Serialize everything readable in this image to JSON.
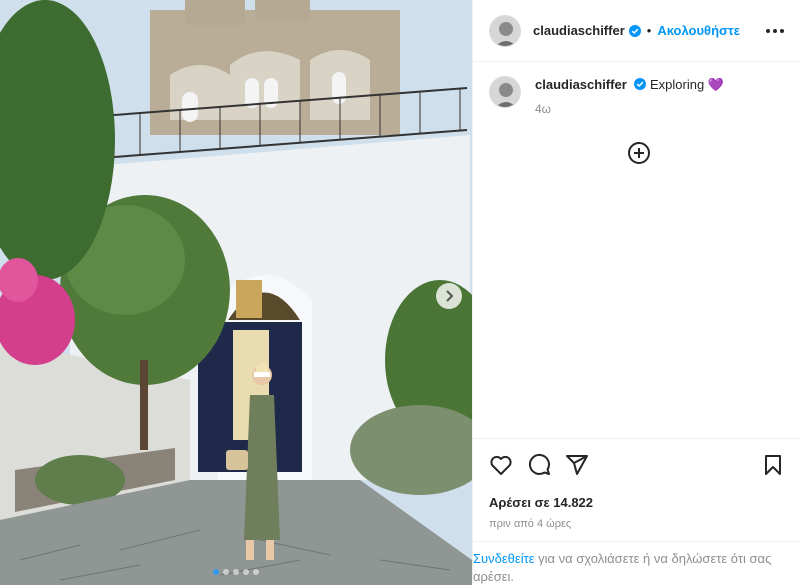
{
  "post": {
    "username": "claudiaschiffer",
    "follow_label": "Ακολουθήστε",
    "separator": "•",
    "caption_user": "claudiaschiffer",
    "caption_text": "Exploring",
    "caption_emoji": "💜",
    "caption_age": "4ω",
    "likes_text": "Αρέσει σε 14.822",
    "posted_ago": "πριν από 4 ώρες",
    "login_link": "Συνδεθείτε",
    "login_rest": " για να σχολιάσετε ή να δηλώσετε ότι σας αρέσει."
  },
  "carousel": {
    "total_slides": 5,
    "active_index": 0
  },
  "colors": {
    "link": "#0095f6",
    "verified": "#0095f6",
    "muted": "#8e8e8e"
  },
  "icons": [
    "ellipsis-icon",
    "add-comment-icon",
    "heart-icon",
    "comment-icon",
    "share-icon",
    "bookmark-icon",
    "verified-badge-icon",
    "chevron-right-icon"
  ]
}
